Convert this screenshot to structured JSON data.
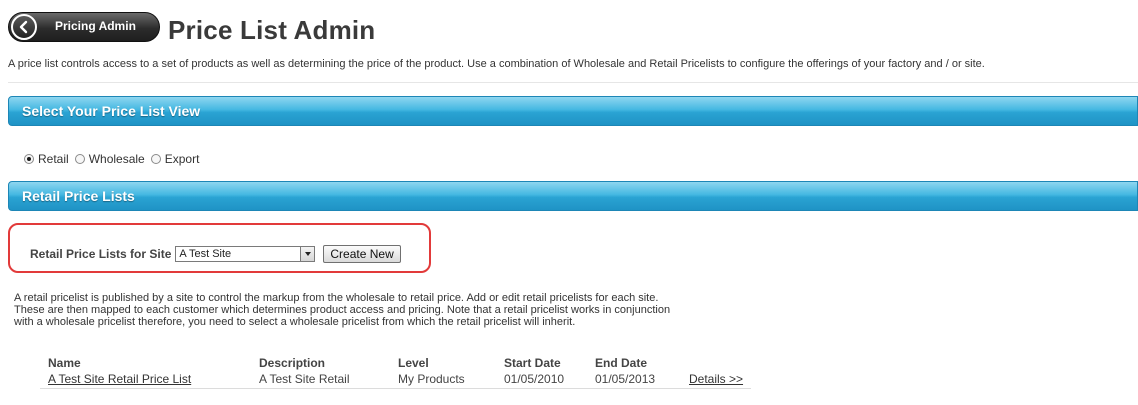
{
  "header": {
    "back_label": "Pricing Admin",
    "title": "Price List Admin"
  },
  "intro": "A price list controls access to a set of products as well as determining the price of the product. Use a combination of Wholesale and Retail Pricelists to configure the offerings of your factory and / or site.",
  "view_section": {
    "title": "Select Your Price List View",
    "options": [
      {
        "label": "Retail",
        "checked": true
      },
      {
        "label": "Wholesale",
        "checked": false
      },
      {
        "label": "Export",
        "checked": false
      }
    ]
  },
  "retail_section": {
    "title": "Retail Price Lists",
    "site_label": "Retail Price Lists for Site",
    "site_selected": "A Test Site",
    "create_button": "Create New",
    "description_lines": [
      "A retail pricelist is published by a site to control the markup from the wholesale to retail price. Add or edit retail pricelists for each site.",
      "These are then mapped to each customer which determines product access and pricing. Note that a retail pricelist works in conjunction",
      "with a wholesale pricelist therefore, you need to select a wholesale pricelist from which the retail pricelist will inherit."
    ],
    "table": {
      "columns": [
        "Name",
        "Description",
        "Level",
        "Start Date",
        "End Date",
        ""
      ],
      "rows": [
        [
          "A Test Site Retail Price List",
          "A Test Site Retail",
          "My Products",
          "01/05/2010",
          "01/05/2013",
          "Details >>"
        ]
      ]
    }
  },
  "colors": {
    "section_bar": "#2aa3d3",
    "highlight_border": "#e23a3a"
  }
}
